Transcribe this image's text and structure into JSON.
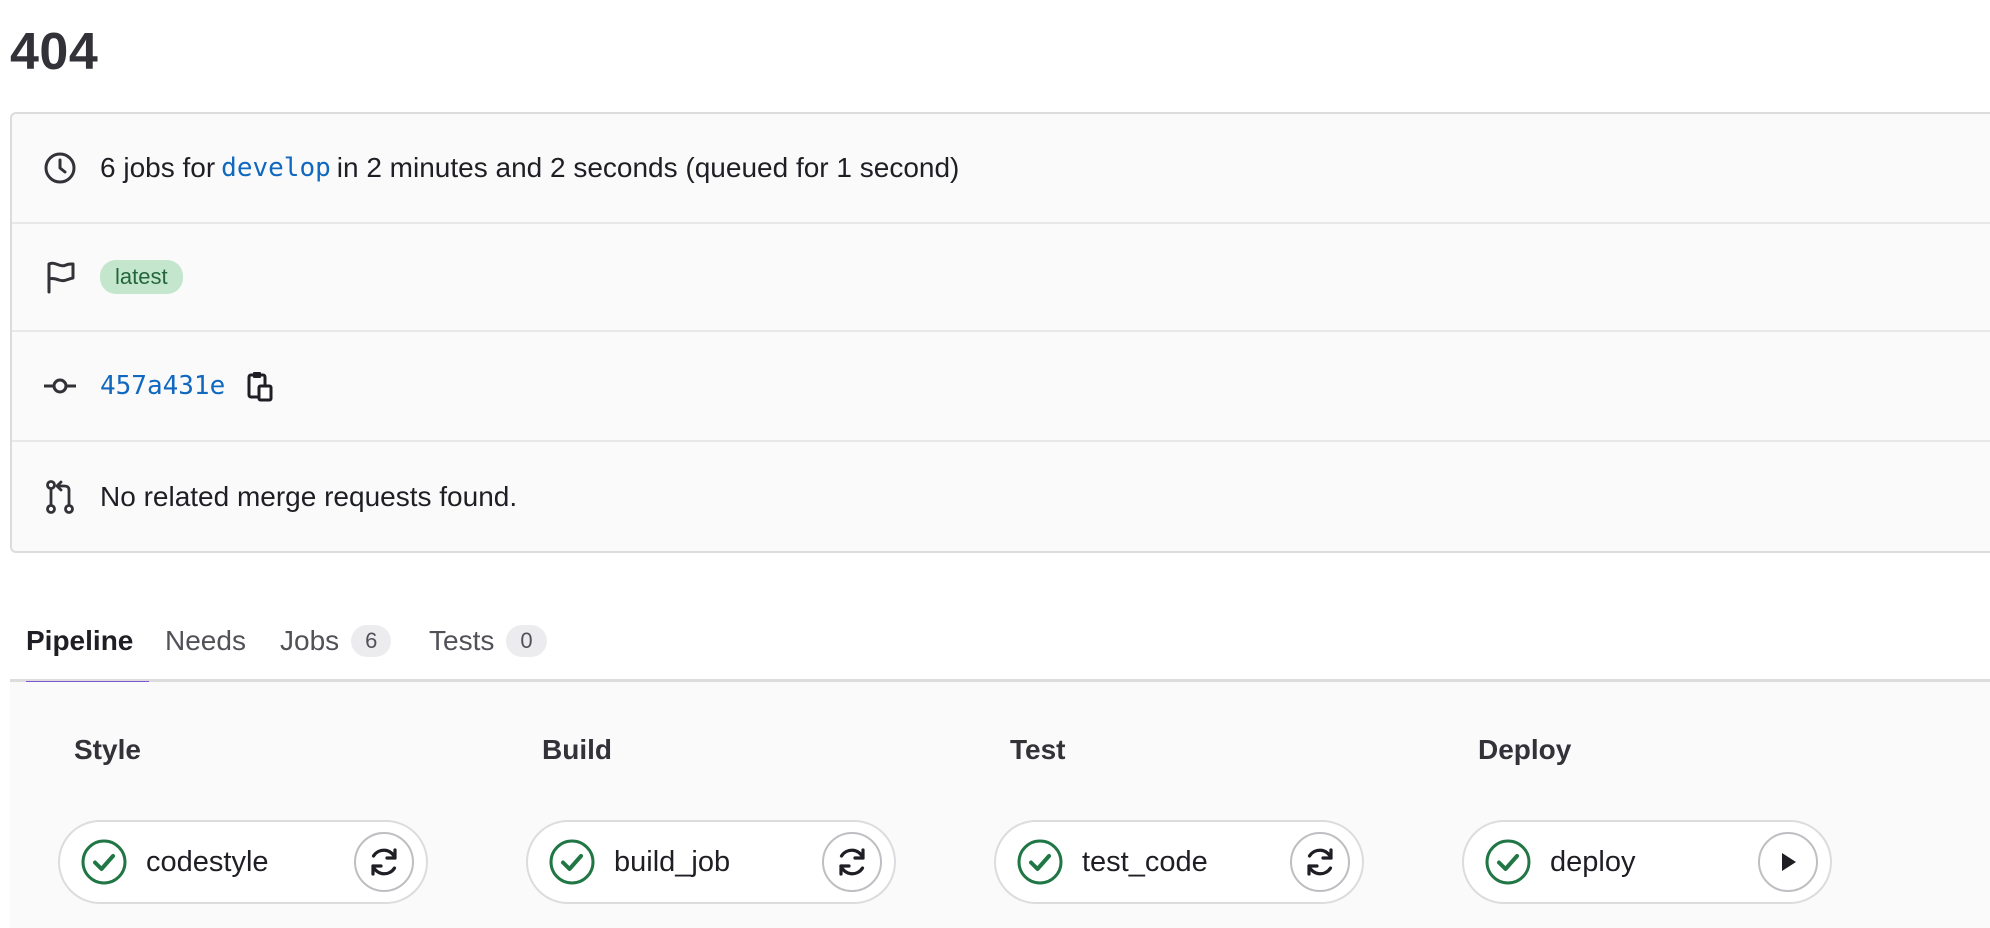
{
  "page": {
    "title": "404"
  },
  "summary": {
    "jobs_prefix": "6 jobs for",
    "branch": "develop",
    "jobs_suffix": "in 2 minutes and 2 seconds (queued for 1 second)",
    "badge": "latest",
    "commit_sha": "457a431e",
    "merge_requests_text": "No related merge requests found."
  },
  "tabs": [
    {
      "label": "Pipeline",
      "active": true
    },
    {
      "label": "Needs"
    },
    {
      "label": "Jobs",
      "count": "6"
    },
    {
      "label": "Tests",
      "count": "0"
    }
  ],
  "stages": [
    {
      "title": "Style",
      "job": {
        "name": "codestyle",
        "status": "passed",
        "action": "retry-icon"
      }
    },
    {
      "title": "Build",
      "job": {
        "name": "build_job",
        "status": "passed",
        "action": "retry-icon"
      }
    },
    {
      "title": "Test",
      "job": {
        "name": "test_code",
        "status": "passed",
        "action": "retry-icon"
      }
    },
    {
      "title": "Deploy",
      "job": {
        "name": "deploy",
        "status": "passed",
        "action": "play-icon"
      }
    }
  ],
  "colors": {
    "accent_tab": "#7b58cf",
    "link": "#1068bf",
    "success": "#217645",
    "badge_bg": "#c3e6cd",
    "badge_text": "#24663b"
  }
}
